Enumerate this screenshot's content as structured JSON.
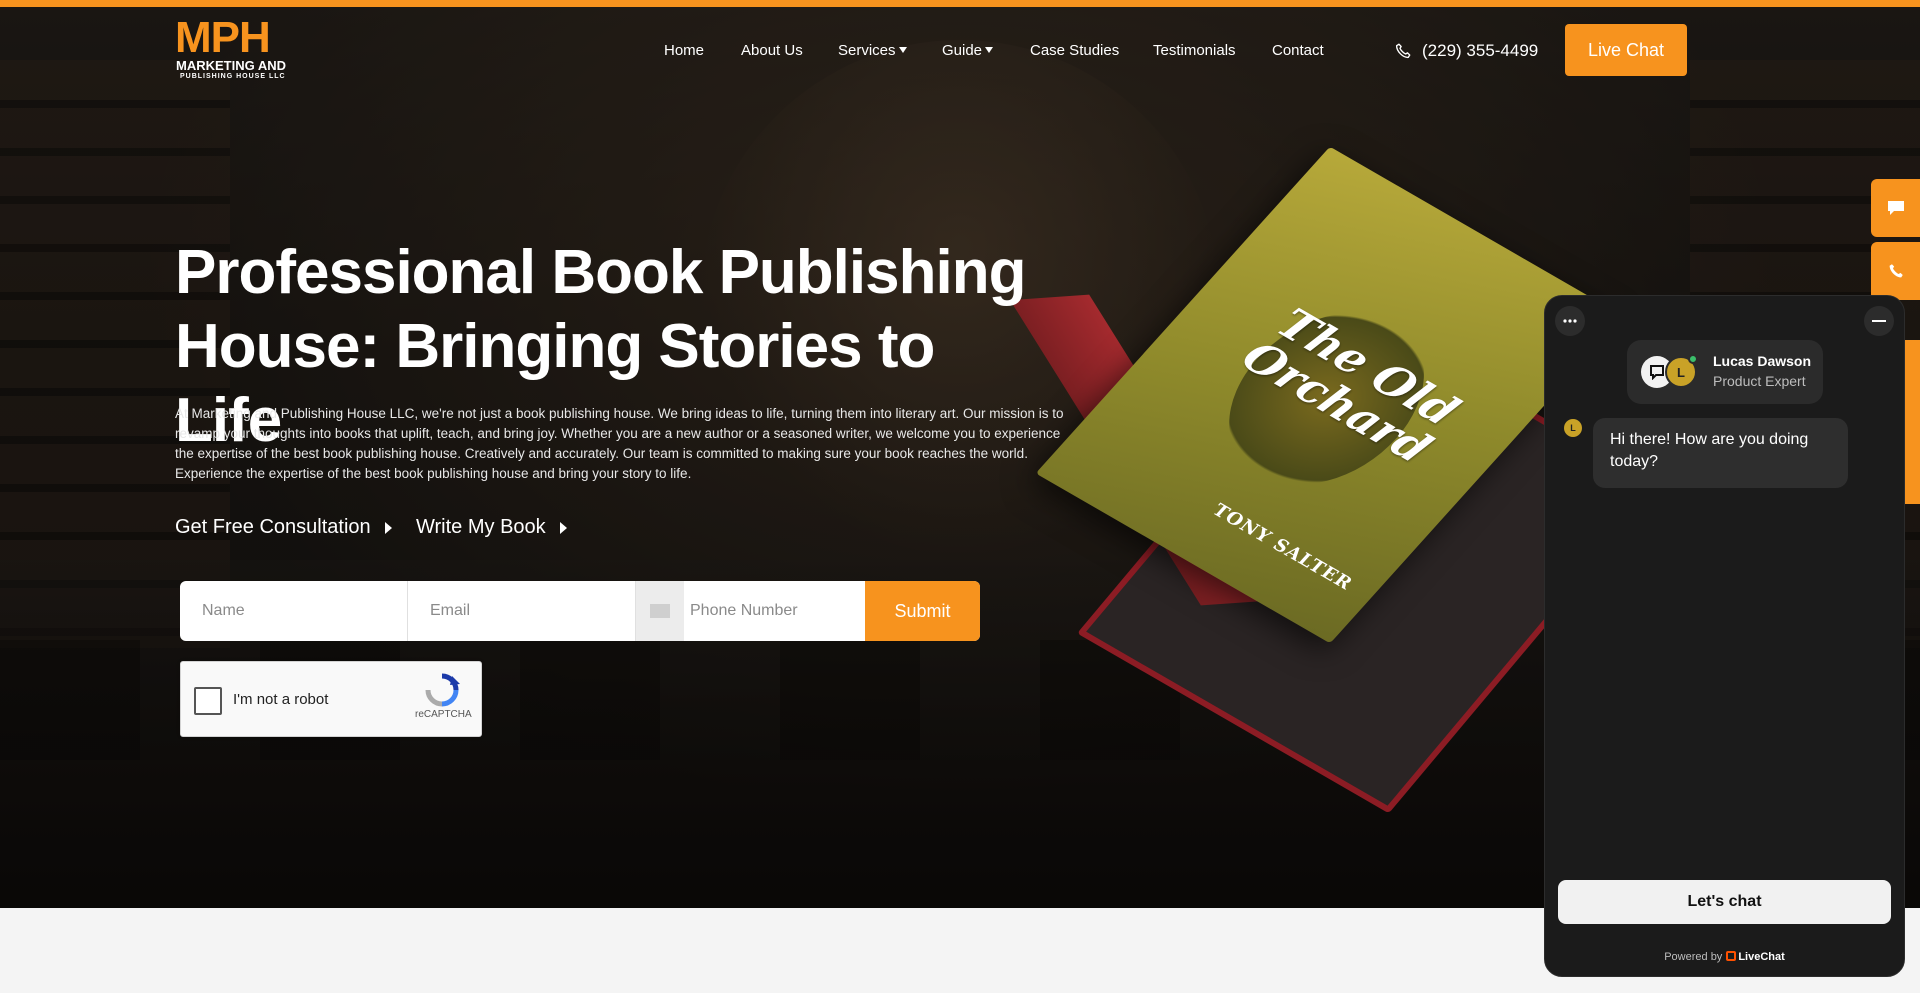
{
  "brand": {
    "logo_main": "MPH",
    "logo_line1": "MARKETING AND",
    "logo_line2": "PUBLISHING HOUSE LLC",
    "accent": "#f7931e"
  },
  "nav": {
    "items": [
      "Home",
      "About Us",
      "Services",
      "Guide",
      "Case Studies",
      "Testimonials",
      "Contact"
    ],
    "phone": "(229) 355-4499",
    "live_chat": "Live Chat"
  },
  "hero": {
    "title": "Professional Book Publishing House: Bringing Stories to Life",
    "description": "At Marketing and Publishing House LLC, we're not just a book publishing house. We bring ideas to life, turning them into literary art. Our mission is to revamp your thoughts into books that uplift, teach, and bring joy. Whether you are a new author or a seasoned writer, we welcome you to experience the expertise of the best book publishing house. Creatively and accurately. Our team is committed to making sure your book reaches the world. Experience the expertise of the best book publishing house and bring your story to life.",
    "cta_primary": "Get Free Consultation",
    "cta_secondary": "Write My Book"
  },
  "form": {
    "name_placeholder": "Name",
    "email_placeholder": "Email",
    "phone_placeholder": "Phone Number",
    "submit": "Submit",
    "captcha_label": "I'm not a robot",
    "captcha_brand": "reCAPTCHA"
  },
  "book": {
    "title": "The Old Orchard",
    "author": "TONY SALTER"
  },
  "chat": {
    "agent_name": "Lucas Dawson",
    "agent_role": "Product Expert",
    "agent_initial": "L",
    "message": "Hi there! How are you doing today?",
    "cta": "Let's chat",
    "powered_prefix": "Powered by",
    "powered_brand": "LiveChat"
  }
}
